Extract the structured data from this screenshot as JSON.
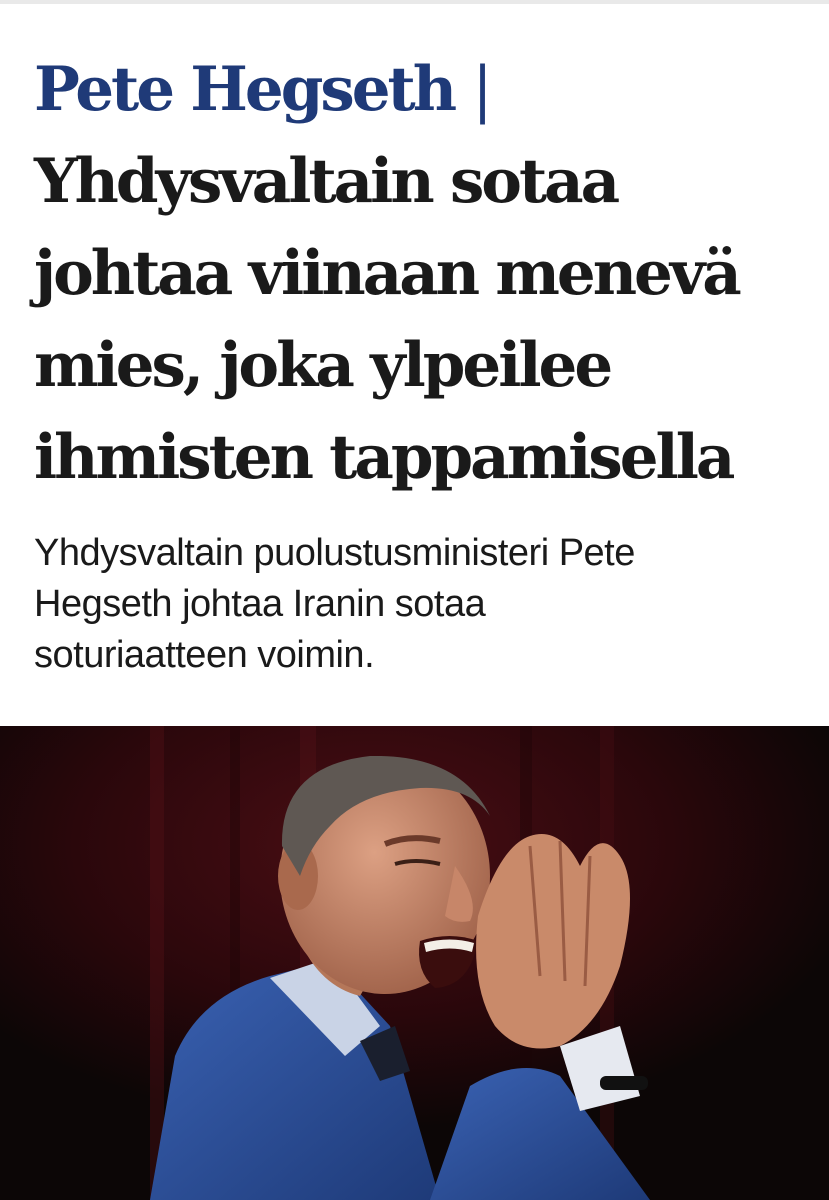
{
  "article": {
    "kicker": "Pete Hegseth",
    "separator": "|",
    "headline_lines": [
      "Yhdysvaltain sotaa",
      "johtaa viinaan menevä",
      "mies, joka ylpeilee",
      "ihmisten tappamisella"
    ],
    "lead_lines": [
      "Yhdysvaltain puolustusministeri Pete",
      "Hegseth johtaa Iranin sotaa",
      "soturiaatteen voimin."
    ]
  },
  "photo": {
    "subject": "man-shouting-with-hands-cupped",
    "colors": {
      "curtain": "#3a0a0e",
      "background": "#0c0606",
      "suit": "#2c4f9a",
      "skin": "#c98a6a"
    }
  },
  "colors": {
    "kicker": "#1f3a78",
    "text": "#1a1a1a",
    "background": "#ffffff"
  }
}
